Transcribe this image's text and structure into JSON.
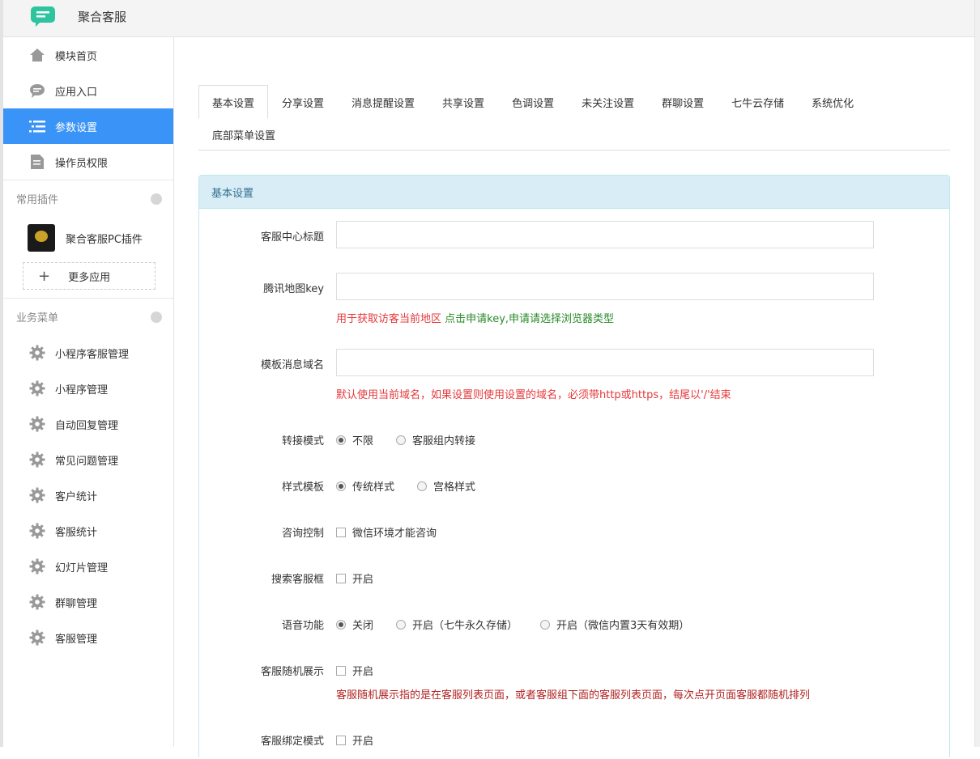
{
  "header": {
    "app_title": "聚合客服"
  },
  "sidebar": {
    "top_items": [
      {
        "label": "模块首页",
        "icon": "home-icon"
      },
      {
        "label": "应用入口",
        "icon": "chat-icon"
      },
      {
        "label": "参数设置",
        "icon": "list-icon",
        "active": true
      },
      {
        "label": "操作员权限",
        "icon": "document-icon"
      }
    ],
    "plugins_section": "常用插件",
    "plugin": "聚合客服PC插件",
    "more_apps": "更多应用",
    "business_section": "业务菜单",
    "business_items": [
      "小程序客服管理",
      "小程序管理",
      "自动回复管理",
      "常见问题管理",
      "客户统计",
      "客服统计",
      "幻灯片管理",
      "群聊管理",
      "客服管理"
    ]
  },
  "tabs": [
    "基本设置",
    "分享设置",
    "消息提醒设置",
    "共享设置",
    "色调设置",
    "未关注设置",
    "群聊设置",
    "七牛云存储",
    "系统优化",
    "底部菜单设置"
  ],
  "panel": {
    "title": "基本设置",
    "fields": {
      "center_title": {
        "label": "客服中心标题",
        "value": ""
      },
      "map_key": {
        "label": "腾讯地图key",
        "value": "",
        "help_red": "用于获取访客当前地区 ",
        "help_green": "点击申请key,申请请选择浏览器类型"
      },
      "template_domain": {
        "label": "模板消息域名",
        "value": "",
        "help": "默认使用当前域名，如果设置则使用设置的域名，必须带http或https，结尾以'/'结束"
      },
      "transfer_mode": {
        "label": "转接模式",
        "options": [
          "不限",
          "客服组内转接"
        ],
        "selected": 0
      },
      "style_template": {
        "label": "样式模板",
        "options": [
          "传统样式",
          "宫格样式"
        ],
        "selected": 0
      },
      "consult_control": {
        "label": "咨询控制",
        "check_label": "微信环境才能咨询"
      },
      "search_box": {
        "label": "搜索客服框",
        "check_label": "开启"
      },
      "voice": {
        "label": "语音功能",
        "options": [
          "关闭",
          "开启（七牛永久存储）",
          "开启（微信内置3天有效期）"
        ],
        "selected": 0
      },
      "random_display": {
        "label": "客服随机展示",
        "check_label": "开启",
        "help": "客服随机展示指的是在客服列表页面，或者客服组下面的客服列表页面，每次点开页面客服都随机排列"
      },
      "bind_mode": {
        "label": "客服绑定模式",
        "check_label": "开启"
      }
    }
  },
  "colors": {
    "active_nav": "#3a93f6",
    "panel_head": "#d9edf7",
    "help_red": "#e4393c",
    "help_green": "#2a8a2a",
    "logo": "#2ec4a0"
  }
}
